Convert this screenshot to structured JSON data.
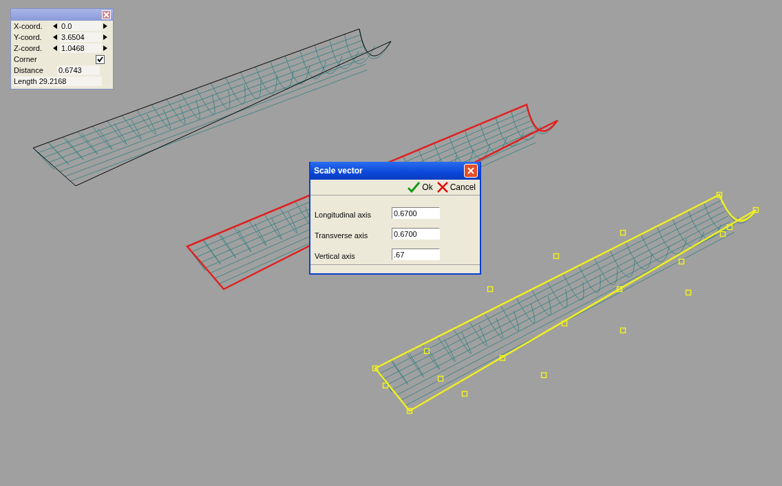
{
  "coordinate_panel": {
    "rows": [
      {
        "kind": "stepper",
        "label": "X-coord.",
        "value": "0.0"
      },
      {
        "kind": "stepper",
        "label": "Y-coord.",
        "value": "3.6504"
      },
      {
        "kind": "stepper",
        "label": "Z-coord.",
        "value": "1.0468"
      },
      {
        "kind": "checkbox",
        "label": "Corner",
        "checked": true
      },
      {
        "kind": "readout",
        "label": "Distance",
        "value": "0.6743"
      },
      {
        "kind": "inline",
        "label": "Length",
        "value": "29.2168"
      }
    ]
  },
  "dialog": {
    "title": "Scale vector",
    "ok": "Ok",
    "cancel": "Cancel",
    "fields": [
      {
        "label": "Longitudinal axis",
        "value": "0.6700"
      },
      {
        "label": "Transverse axis",
        "value": "0.6700"
      },
      {
        "label": "Vertical axis",
        "value": ".67"
      }
    ]
  }
}
